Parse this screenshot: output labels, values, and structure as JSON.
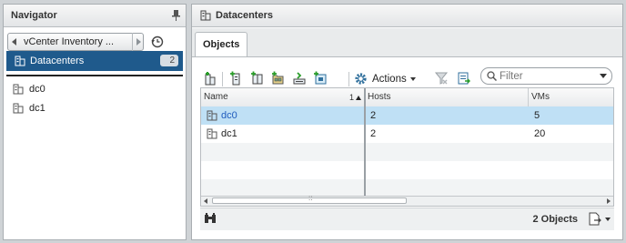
{
  "navigator": {
    "title": "Navigator",
    "back_label": "vCenter Inventory ...",
    "selected": {
      "label": "Datacenters",
      "count": "2"
    },
    "items": [
      {
        "label": "dc0"
      },
      {
        "label": "dc1"
      }
    ]
  },
  "main": {
    "title": "Datacenters",
    "tabs": [
      {
        "label": "Objects",
        "active": true
      }
    ],
    "toolbar": {
      "icons": [
        "new-datacenter-icon",
        "add-host-icon",
        "new-cluster-icon",
        "new-folder-icon",
        "deploy-ovf-icon",
        "new-vm-icon"
      ],
      "actions_label": "Actions",
      "filter_placeholder": "Filter"
    },
    "table": {
      "columns": [
        {
          "label": "Name",
          "sort": "1"
        },
        {
          "label": "Hosts"
        },
        {
          "label": "VMs"
        }
      ],
      "rows": [
        {
          "name": "dc0",
          "hosts": "2",
          "vms": "5",
          "selected": true
        },
        {
          "name": "dc1",
          "hosts": "2",
          "vms": "20",
          "selected": false
        }
      ]
    },
    "footer": {
      "count_label": "2 Objects"
    }
  },
  "colors": {
    "selection_dark": "#1f5a8c",
    "row_selected": "#bfe0f5",
    "link": "#1f5bbd"
  }
}
